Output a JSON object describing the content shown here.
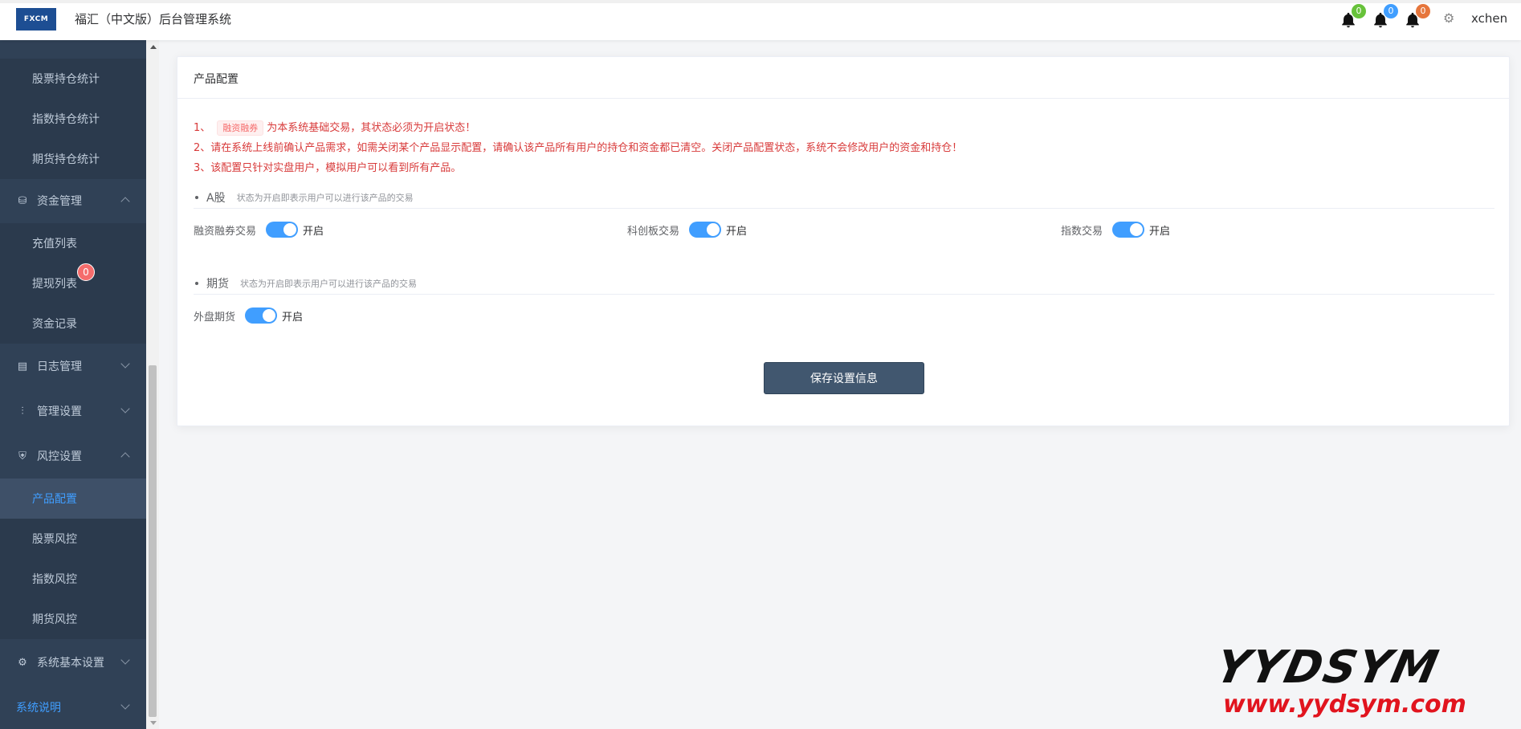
{
  "header": {
    "logo_text": "FXCM",
    "title": "福汇（中文版）后台管理系统",
    "username": "xchen",
    "bells": [
      {
        "count": "0",
        "color": "#67c23a"
      },
      {
        "count": "0",
        "color": "#409eff"
      },
      {
        "count": "0",
        "color": "#e6763c"
      }
    ]
  },
  "sidebar": {
    "items": [
      {
        "label": "股票持仓统计"
      },
      {
        "label": "指数持仓统计"
      },
      {
        "label": "期货持仓统计"
      },
      {
        "label": "资金管理"
      },
      {
        "label": "充值列表"
      },
      {
        "label": "提现列表",
        "badge": "0"
      },
      {
        "label": "资金记录"
      },
      {
        "label": "日志管理"
      },
      {
        "label": "管理设置"
      },
      {
        "label": "风控设置"
      },
      {
        "label": "产品配置"
      },
      {
        "label": "股票风控"
      },
      {
        "label": "指数风控"
      },
      {
        "label": "期货风控"
      },
      {
        "label": "系统基本设置"
      },
      {
        "label": "系统说明"
      }
    ]
  },
  "card": {
    "title": "产品配置",
    "notices": {
      "n1_prefix": "1、",
      "n1_tag": "融资融券",
      "n1_text": "为本系统基础交易，其状态必须为开启状态！",
      "n2": "2、请在系统上线前确认产品需求，如需关闭某个产品显示配置，请确认该产品所有用户的持仓和资金都已清空。关闭产品配置状态，系统不会修改用户的资金和持仓！",
      "n3": "3、该配置只针对实盘用户，模拟用户可以看到所有产品。"
    },
    "sections": [
      {
        "title": "A股",
        "hint": "状态为开启即表示用户可以进行该产品的交易",
        "switches": [
          {
            "label": "融资融券交易",
            "state": "开启",
            "on": true
          },
          {
            "label": "科创板交易",
            "state": "开启",
            "on": true
          },
          {
            "label": "指数交易",
            "state": "开启",
            "on": true
          }
        ]
      },
      {
        "title": "期货",
        "hint": "状态为开启即表示用户可以进行该产品的交易",
        "switches": [
          {
            "label": "外盘期货",
            "state": "开启",
            "on": true
          }
        ]
      }
    ],
    "save_label": "保存设置信息"
  },
  "watermark": {
    "big": "YYDSYM",
    "url": "www.yydsym.com"
  }
}
